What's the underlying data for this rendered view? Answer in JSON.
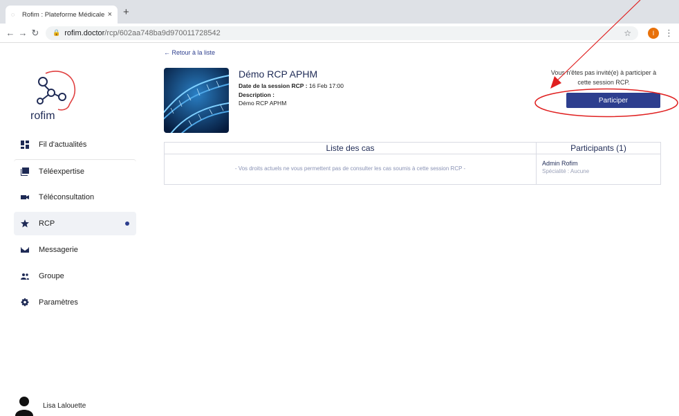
{
  "browser": {
    "tab_title": "Rofim : Plateforme Médicale, T",
    "tab_close": "×",
    "new_tab": "+",
    "url_host": "rofim.doctor",
    "url_path": "/rcp/602aa748ba9d970011728542",
    "profile_initial": "I"
  },
  "sidebar": {
    "logo_text": "rofim",
    "items": [
      {
        "label": "Fil d'actualités",
        "icon": "dashboard-icon"
      },
      {
        "label": "Téléexpertise",
        "icon": "library-icon"
      },
      {
        "label": "Téléconsultation",
        "icon": "video-camera-icon"
      },
      {
        "label": "RCP",
        "icon": "star-icon",
        "active": true
      },
      {
        "label": "Messagerie",
        "icon": "mail-icon"
      },
      {
        "label": "Groupe",
        "icon": "group-icon"
      },
      {
        "label": "Paramètres",
        "icon": "gear-icon"
      }
    ],
    "user_name": "Lisa Lalouette"
  },
  "main": {
    "back_link": "← Retour à la liste",
    "session_title": "Démo RCP APHM",
    "date_label": "Date de la session RCP :",
    "date_value": "16 Feb 17:00",
    "description_label": "Description :",
    "description_value": "Démo RCP APHM",
    "invite_text": "Vous n'êtes pas invité(e) à participer à cette session RCP.",
    "participate_button": "Participer",
    "cases_header": "Liste des cas",
    "cases_message": "- Vos droits actuels ne vous permettent pas de consulter les cas soumis à cette session RCP -",
    "participants_header": "Participants (1)",
    "participant_name": "Admin Rofim",
    "participant_specialty": "Spécialité : Aucune"
  },
  "colors": {
    "primary": "#2d3e8e",
    "annotation": "#e02020"
  }
}
